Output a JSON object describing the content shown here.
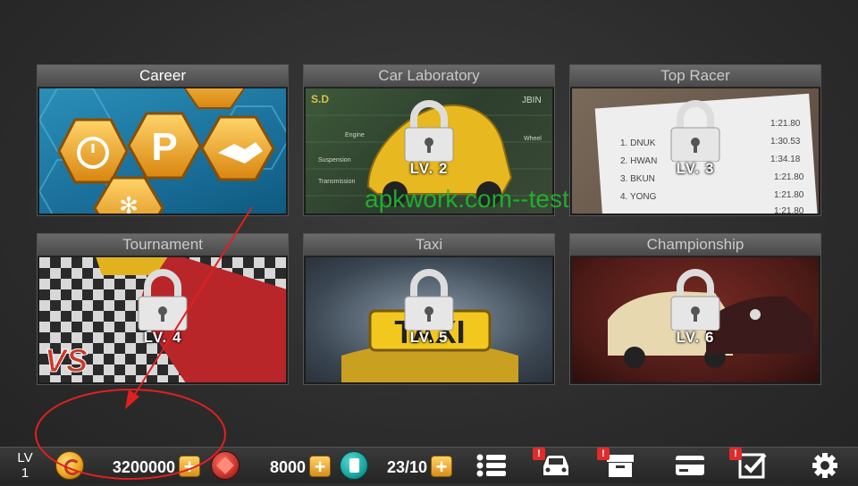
{
  "modes": [
    {
      "title": "Career",
      "locked": false,
      "level_label": ""
    },
    {
      "title": "Car Laboratory",
      "locked": true,
      "level_label": "LV. 2"
    },
    {
      "title": "Top Racer",
      "locked": true,
      "level_label": "LV. 3"
    },
    {
      "title": "Tournament",
      "locked": true,
      "level_label": "LV. 4"
    },
    {
      "title": "Taxi",
      "locked": true,
      "level_label": "LV. 5"
    },
    {
      "title": "Championship",
      "locked": true,
      "level_label": "LV. 6"
    }
  ],
  "watermark": "apkwork.com--test",
  "status_bar": {
    "level_label": "LV",
    "level_value": "1",
    "coins": "3200000",
    "gems": "8000",
    "fuel": "23/10",
    "plus_label": "+",
    "badge_label": "!"
  },
  "colors": {
    "accent_gold": "#e8a21a",
    "gem_red": "#c8322a",
    "fuel_teal": "#1aa6a0",
    "badge_red": "#e12a2a",
    "annotation_red": "#e02020"
  },
  "career_art": {
    "center_label": "P"
  },
  "lab_art": {
    "brand": "S.D",
    "corner": "JBIN",
    "labels": [
      "Engine",
      "Suspension",
      "Transmission",
      "Wheel"
    ]
  },
  "top_racer_art": {
    "names": [
      "1. DNUK",
      "2. HWAN",
      "3. BKUN",
      "4. YONG"
    ],
    "times": [
      "1:21.80",
      "1:30.53",
      "1:34.18",
      "1:21.80",
      "1:21.80",
      "1:21.80"
    ]
  },
  "tournament_art": {
    "vs_label": "VS"
  },
  "taxi_art": {
    "sign": "TAXI"
  }
}
